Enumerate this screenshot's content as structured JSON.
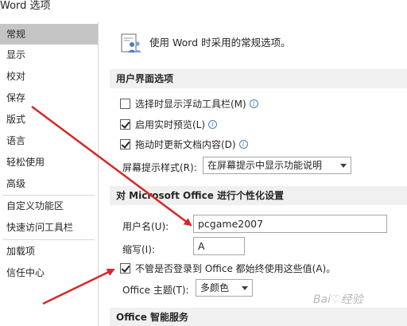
{
  "window": {
    "title": "Word 选项"
  },
  "sidebar": {
    "items": [
      {
        "label": "常规",
        "selected": true
      },
      {
        "label": "显示"
      },
      {
        "label": "校对"
      },
      {
        "label": "保存"
      },
      {
        "label": "版式"
      },
      {
        "label": "语言"
      },
      {
        "label": "轻松使用"
      },
      {
        "label": "高级"
      },
      {
        "label": "自定义功能区"
      },
      {
        "label": "快速访问工具栏"
      },
      {
        "label": "加载项"
      },
      {
        "label": "信任中心"
      }
    ]
  },
  "main": {
    "header": "使用 Word 时采用的常规选项。",
    "ui_section": {
      "title": "用户界面选项",
      "mini_toolbar": {
        "label": "选择时显示浮动工具栏(M)",
        "checked": false
      },
      "live_preview": {
        "label": "启用实时预览(L)",
        "checked": true
      },
      "update_drag": {
        "label": "拖动时更新文档内容(D)",
        "checked": true
      },
      "screentip_label": "屏幕提示样式(R):",
      "screentip_value": "在屏幕提示中显示功能说明"
    },
    "personalize_section": {
      "title": "对 Microsoft Office 进行个性化设置",
      "username_label": "用户名(U):",
      "username_value": "pcgame2007",
      "initials_label": "缩写(I):",
      "initials_value": "A",
      "always_use": {
        "label": "不管是否登录到 Office 都始终使用这些值(A)。",
        "checked": true
      },
      "theme_label": "Office 主题(T):",
      "theme_value": "多颜色"
    },
    "intelligent_section": {
      "title": "Office 智能服务"
    }
  },
  "watermark": "Bai♡经验",
  "colors": {
    "selected_nav": "#c5c5c5",
    "section_bg": "#f0f0f0",
    "arrow": "#d62828"
  }
}
